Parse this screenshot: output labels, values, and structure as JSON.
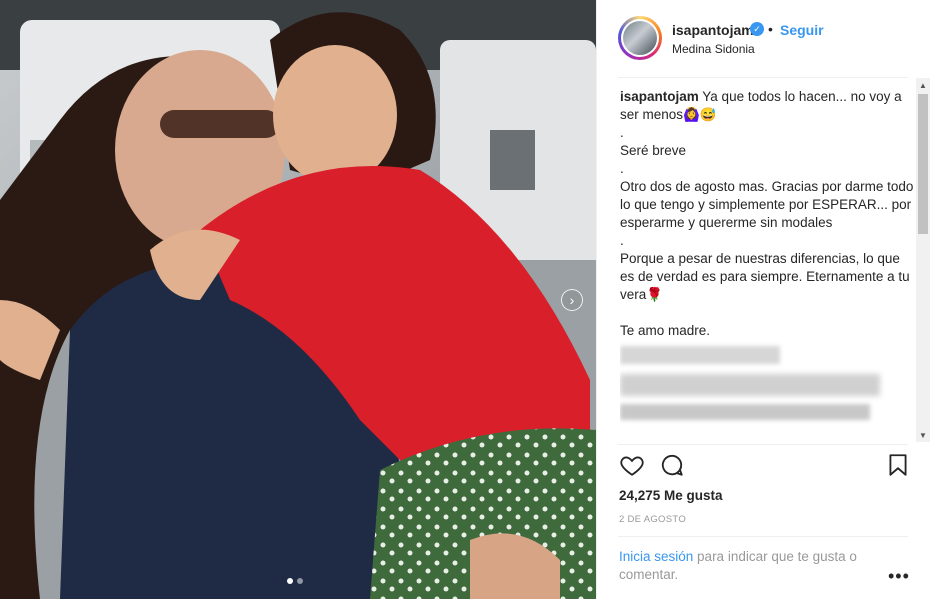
{
  "post": {
    "username": "isapantojam",
    "follow_label": "Seguir",
    "bullet": "•",
    "location": "Medina Sidonia",
    "caption": {
      "user": "isapantojam",
      "lines": [
        "Ya que todos lo hacen... no voy a ser menos🙆‍♀️😅",
        ".",
        "Seré breve",
        ".",
        "Otro dos de agosto mas. Gracias por darme todo lo que tengo y simplemente por ESPERAR... por esperarme y quererme sin modales",
        ".",
        "Porque a pesar de nuestras diferencias, lo que es de verdad es para siempre. Eternamente a tu vera🌹",
        "",
        "Te amo madre."
      ]
    },
    "likes": "24,275 Me gusta",
    "date": "2 DE AGOSTO",
    "login_link": "Inicia sesión",
    "login_rest": " para indicar que te gusta o comentar.",
    "more": "•••"
  },
  "icons": {
    "like": "heart-icon",
    "comment": "comment-bubble-icon",
    "save": "bookmark-icon",
    "verified": "verified-badge-icon",
    "next": "chevron-right-icon"
  },
  "carousel": {
    "count": 2,
    "active": 1
  },
  "colors": {
    "link": "#3897f0",
    "text": "#262626",
    "muted": "#999999"
  }
}
